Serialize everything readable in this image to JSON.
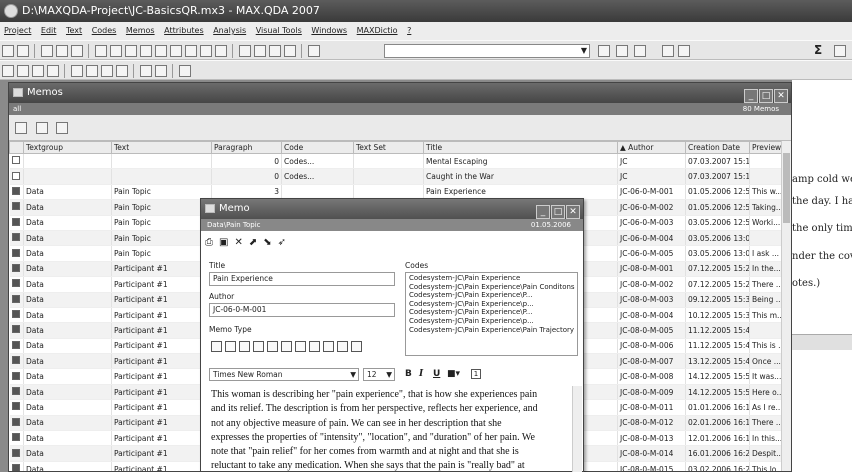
{
  "window": {
    "title": "D:\\MAXQDA-Project\\JC-BasicsQR.mx3 - MAX.QDA 2007"
  },
  "menu": [
    "Project",
    "Edit",
    "Text",
    "Codes",
    "Memos",
    "Attributes",
    "Analysis",
    "Visual Tools",
    "Windows",
    "MAXDictio",
    "?"
  ],
  "toolbar": {
    "sigma": "Σ"
  },
  "right_pane": {
    "lines": [
      "amp cold wea",
      "the day. I hat",
      "the only time",
      "nder the cove",
      "otes.)"
    ]
  },
  "memos_window": {
    "title": "Memos",
    "subheader_left": "all",
    "subheader_right": "80 Memos",
    "columns": [
      "",
      "Textgroup",
      "Text",
      "Paragraph",
      "Code",
      "Text Set",
      "Title",
      "Author",
      "Creation Date",
      "Preview"
    ],
    "sort_indicator": "▲",
    "rows": [
      {
        "tg": "",
        "text": "",
        "para": "0",
        "code": "Codes...",
        "set": "",
        "title": "Mental Escaping",
        "author": "JC",
        "date": "07.03.2007 15:16",
        "prev": ""
      },
      {
        "tg": "",
        "text": "",
        "para": "0",
        "code": "Codes...",
        "set": "",
        "title": "Caught in the War",
        "author": "JC",
        "date": "07.03.2007 15:19",
        "prev": ""
      },
      {
        "tg": "Data",
        "text": "Pain Topic",
        "para": "3",
        "code": "",
        "set": "",
        "title": "Pain Experience",
        "author": "JC-06-0-M-001",
        "date": "01.05.2006 12:50",
        "prev": "This w..."
      },
      {
        "tg": "Data",
        "text": "Pain Topic",
        "para": "",
        "code": "",
        "set": "",
        "title": "",
        "author": "JC-06-0-M-002",
        "date": "01.05.2006 12:52",
        "prev": "Taking..."
      },
      {
        "tg": "Data",
        "text": "Pain Topic",
        "para": "",
        "code": "",
        "set": "",
        "title": "",
        "author": "JC-06-0-M-003",
        "date": "03.05.2006 12:54",
        "prev": "Worki..."
      },
      {
        "tg": "Data",
        "text": "Pain Topic",
        "para": "",
        "code": "",
        "set": "",
        "title": "",
        "author": "JC-06-0-M-004",
        "date": "03.05.2006 13:01",
        "prev": ""
      },
      {
        "tg": "Data",
        "text": "Pain Topic",
        "para": "",
        "code": "",
        "set": "",
        "title": "",
        "author": "JC-06-0-M-005",
        "date": "03.05.2006 13:04",
        "prev": "I ask ..."
      },
      {
        "tg": "Data",
        "text": "Participant #1",
        "para": "",
        "code": "",
        "set": "",
        "title": "",
        "author": "JC-08-0-M-001",
        "date": "07.12.2005 15:26",
        "prev": "In the..."
      },
      {
        "tg": "Data",
        "text": "Participant #1",
        "para": "",
        "code": "",
        "set": "",
        "title": "",
        "author": "JC-08-0-M-002",
        "date": "07.12.2005 15:29",
        "prev": "There ..."
      },
      {
        "tg": "Data",
        "text": "Participant #1",
        "para": "",
        "code": "",
        "set": "",
        "title": "",
        "author": "JC-08-0-M-003",
        "date": "09.12.2005 15:32",
        "prev": "Being ..."
      },
      {
        "tg": "Data",
        "text": "Participant #1",
        "para": "",
        "code": "",
        "set": "",
        "title": "",
        "author": "JC-08-0-M-004",
        "date": "10.12.2005 15:35",
        "prev": "This m..."
      },
      {
        "tg": "Data",
        "text": "Participant #1",
        "para": "",
        "code": "",
        "set": "",
        "title": "",
        "author": "JC-08-0-M-005",
        "date": "11.12.2005 15:40",
        "prev": ""
      },
      {
        "tg": "Data",
        "text": "Participant #1",
        "para": "",
        "code": "",
        "set": "",
        "title": "",
        "author": "JC-08-0-M-006",
        "date": "11.12.2005 15:43",
        "prev": "This is ..."
      },
      {
        "tg": "Data",
        "text": "Participant #1",
        "para": "",
        "code": "",
        "set": "",
        "title": "",
        "author": "JC-08-0-M-007",
        "date": "13.12.2005 15:47",
        "prev": "Once ..."
      },
      {
        "tg": "Data",
        "text": "Participant #1",
        "para": "",
        "code": "",
        "set": "",
        "title": "",
        "author": "JC-08-0-M-008",
        "date": "14.12.2005 15:50",
        "prev": "It was..."
      },
      {
        "tg": "Data",
        "text": "Participant #1",
        "para": "",
        "code": "",
        "set": "",
        "title": "",
        "author": "JC-08-0-M-009",
        "date": "14.12.2005 15:57",
        "prev": "Here o..."
      },
      {
        "tg": "Data",
        "text": "Participant #1",
        "para": "",
        "code": "",
        "set": "",
        "title": "",
        "author": "JC-08-0-M-011",
        "date": "01.01.2006 16:11",
        "prev": "As I re..."
      },
      {
        "tg": "Data",
        "text": "Participant #1",
        "para": "",
        "code": "",
        "set": "",
        "title": "",
        "author": "JC-08-0-M-012",
        "date": "02.01.2006 16:14",
        "prev": "There ..."
      },
      {
        "tg": "Data",
        "text": "Participant #1",
        "para": "",
        "code": "",
        "set": "",
        "title": "",
        "author": "JC-08-0-M-013",
        "date": "12.01.2006 16:19",
        "prev": "In this..."
      },
      {
        "tg": "Data",
        "text": "Participant #1",
        "para": "",
        "code": "",
        "set": "",
        "title": "",
        "author": "JC-08-0-M-014",
        "date": "16.01.2006 16:21",
        "prev": "Despit..."
      },
      {
        "tg": "Data",
        "text": "Participant #1",
        "para": "",
        "code": "",
        "set": "",
        "title": "",
        "author": "JC-08-0-M-015",
        "date": "03.02.2006 16:24",
        "prev": "This lo..."
      },
      {
        "tg": "Data",
        "text": "Participant #1",
        "para": "",
        "code": "",
        "set": "",
        "title": "",
        "author": "JC-08-0-M-016",
        "date": "14.02.2005 16:27",
        "prev": "All me..."
      }
    ]
  },
  "memo_dialog": {
    "title": "Memo",
    "path": "Data\\Pain Topic",
    "date": "01.05.2006",
    "title_label": "Title",
    "title_value": "Pain Experience",
    "author_label": "Author",
    "author_value": "JC-06-0-M-001",
    "memo_type_label": "Memo Type",
    "codes_label": "Codes",
    "codes": [
      "Codesystem-JC\\Pain Experience",
      "Codesystem-JC\\Pain Experience\\Pain Conditons",
      "Codesystem-JC\\Pain Experience\\P...",
      "Codesystem-JC\\Pain Experience\\p...",
      "Codesystem-JC\\Pain Experience\\P...",
      "Codesystem-JC\\Pain Experience\\p...",
      "Codesystem-JC\\Pain Experience\\Pain Trajectory"
    ],
    "font": "Times New Roman",
    "font_size": "12",
    "body_lines": [
      "This woman is describing her \"pain experience\", that is how she experiences pain",
      "and its relief.  The description is from her perspective, reflects her experience, and",
      "not any objective measure of pain.  We can see in her description that she",
      "expresses the properties of \"intensity\", \"location\", and \"duration\" of her pain.  We",
      "note that \"pain relief\" for her comes from warmth and at night and that she is",
      "reluctant to take any medication. When she says that the pain is \"really bad\" at"
    ]
  }
}
